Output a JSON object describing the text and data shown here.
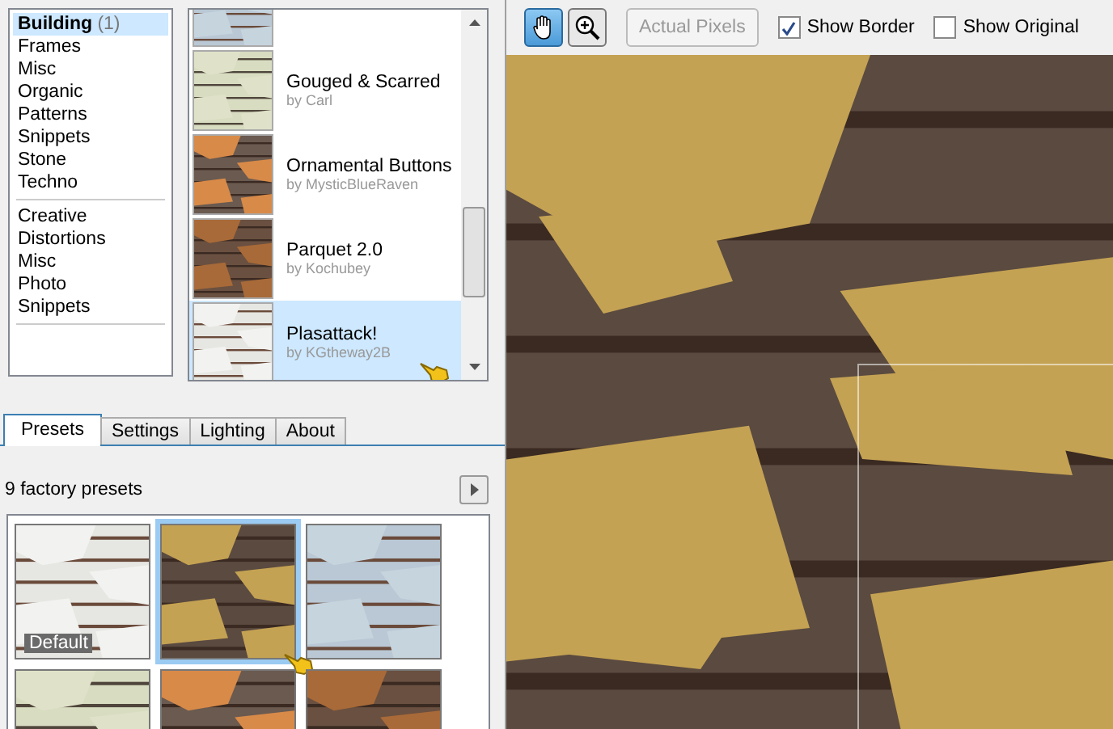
{
  "categories": [
    [
      {
        "label": "Building",
        "count": "(1)",
        "selected": true
      },
      {
        "label": "Frames",
        "selected": false
      },
      {
        "label": "Misc",
        "selected": false
      },
      {
        "label": "Organic",
        "selected": false
      },
      {
        "label": "Patterns",
        "selected": false
      },
      {
        "label": "Snippets",
        "selected": false
      },
      {
        "label": "Stone",
        "selected": false
      },
      {
        "label": "Techno",
        "selected": false
      }
    ],
    [
      {
        "label": "Creative",
        "selected": false
      },
      {
        "label": "Distortions",
        "selected": false
      },
      {
        "label": "Misc",
        "selected": false
      },
      {
        "label": "Photo",
        "selected": false
      },
      {
        "label": "Snippets",
        "selected": false
      }
    ]
  ],
  "filters": [
    {
      "selected": false
    },
    {
      "name": "Gouged & Scarred",
      "author": "by Carl",
      "selected": false
    },
    {
      "name": "Ornamental Buttons",
      "author": "by MysticBlueRaven",
      "selected": false
    },
    {
      "name": "Parquet 2.0",
      "author": "by Kochubey",
      "selected": false
    },
    {
      "name": "Plasattack!",
      "author": "by KGtheway2B",
      "selected": true
    }
  ],
  "tabs": [
    {
      "label": "Presets",
      "selected": true
    },
    {
      "label": "Settings",
      "selected": false
    },
    {
      "label": "Lighting",
      "selected": false
    },
    {
      "label": "About",
      "selected": false
    }
  ],
  "presets_header": "9 factory presets",
  "presets": [
    {
      "label": "Default",
      "selected": false
    },
    {
      "selected": true
    },
    {
      "selected": false
    },
    {
      "selected": false
    },
    {
      "selected": false
    },
    {
      "selected": false
    }
  ],
  "toolbar": {
    "tools": [
      {
        "kind": "hand",
        "selected": true
      },
      {
        "kind": "zoom",
        "selected": false
      }
    ],
    "actual_pixels": {
      "label": "Actual Pixels",
      "disabled": true
    },
    "checkboxes": [
      {
        "label": "Show Border",
        "checked": true
      },
      {
        "label": "Show Original",
        "checked": false
      }
    ]
  },
  "preview": {
    "show_border": true
  }
}
